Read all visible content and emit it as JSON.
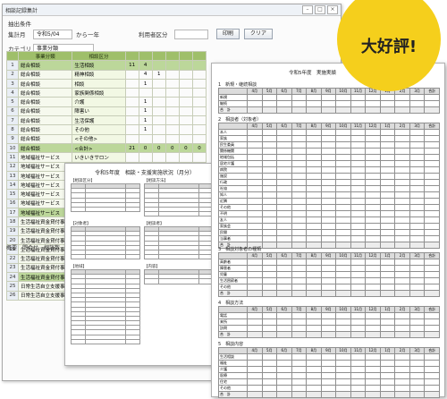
{
  "back_window": {
    "title": "相談記録集計",
    "caption": "抽出条件",
    "filter_row1": {
      "label": "集計月",
      "date_from": "令和5/04",
      "range_text": "から一年",
      "division_label": "利用者区分",
      "print_button": "印刷",
      "clear_button": "クリア"
    },
    "filter_row2": {
      "label": "カテゴリ",
      "category_value": "事業分類"
    },
    "grid": {
      "headers": [
        "事業分類",
        "相談区分",
        "",
        "",
        "",
        "",
        "",
        ""
      ],
      "rows": [
        {
          "n": "1",
          "a": "総合相談",
          "b": "生活相談",
          "v": [
            "11",
            "4",
            "",
            "",
            "",
            ""
          ],
          "hl": true
        },
        {
          "n": "2",
          "a": "総合相談",
          "b": "精神相談",
          "v": [
            "",
            "4",
            "1",
            "",
            "",
            ""
          ]
        },
        {
          "n": "3",
          "a": "総合相談",
          "b": "相談",
          "v": [
            "",
            "1",
            "",
            "",
            "",
            ""
          ]
        },
        {
          "n": "4",
          "a": "総合相談",
          "b": "家族関係相談",
          "v": [
            "",
            "",
            "",
            "",
            "",
            ""
          ]
        },
        {
          "n": "5",
          "a": "総合相談",
          "b": "介護",
          "v": [
            "",
            "1",
            "",
            "",
            "",
            ""
          ]
        },
        {
          "n": "6",
          "a": "総合相談",
          "b": "障害い",
          "v": [
            "",
            "1",
            "",
            "",
            "",
            ""
          ]
        },
        {
          "n": "7",
          "a": "総合相談",
          "b": "生活保護",
          "v": [
            "",
            "1",
            "",
            "",
            "",
            ""
          ]
        },
        {
          "n": "8",
          "a": "総合相談",
          "b": "その他",
          "v": [
            "",
            "1",
            "",
            "",
            "",
            ""
          ]
        },
        {
          "n": "9",
          "a": "総合相談",
          "b": "<その他>",
          "v": [
            "",
            "",
            "",
            "",
            "",
            ""
          ]
        },
        {
          "n": "10",
          "a": "総合相談",
          "b": "<合計>",
          "v": [
            "21",
            "0",
            "0",
            "0",
            "0",
            "0"
          ],
          "hl": true
        },
        {
          "n": "11",
          "a": "地域福祉サービス",
          "b": "いきいきサロン",
          "v": [
            "",
            "",
            "",
            "",
            "",
            ""
          ]
        },
        {
          "n": "12",
          "a": "地域福祉サービス",
          "b": "見守り事業",
          "v": [
            "",
            "",
            "",
            "",
            "",
            ""
          ]
        },
        {
          "n": "13",
          "a": "地域福祉サービス",
          "b": "福祉事業運営",
          "v": [
            "",
            "",
            "",
            "",
            "",
            ""
          ]
        },
        {
          "n": "14",
          "a": "地域福祉サービス",
          "b": "",
          "v": [
            "",
            "",
            "",
            "",
            "",
            ""
          ]
        },
        {
          "n": "15",
          "a": "地域福祉サービス",
          "b": "",
          "v": [
            "",
            "",
            "",
            "",
            "",
            ""
          ]
        },
        {
          "n": "16",
          "a": "地域福祉サービス",
          "b": "",
          "v": [
            "",
            "",
            "",
            "",
            "",
            ""
          ]
        },
        {
          "n": "17",
          "a": "地域福祉サービス",
          "b": "",
          "v": [
            "",
            "",
            "",
            "",
            "",
            ""
          ],
          "hl": true
        },
        {
          "n": "18",
          "a": "生活福祉資金貸付事業",
          "b": "",
          "v": [
            "",
            "",
            "",
            "",
            "",
            ""
          ]
        },
        {
          "n": "19",
          "a": "生活福祉資金貸付事業",
          "b": "",
          "v": [
            "",
            "",
            "",
            "",
            "",
            ""
          ]
        },
        {
          "n": "20",
          "a": "生活福祉資金貸付事業",
          "b": "",
          "v": [
            "",
            "",
            "",
            "",
            "",
            ""
          ]
        },
        {
          "n": "21",
          "a": "生活福祉資金貸付事業",
          "b": "",
          "v": [
            "",
            "",
            "",
            "",
            "",
            ""
          ]
        },
        {
          "n": "22",
          "a": "生活福祉資金貸付事業",
          "b": "",
          "v": [
            "",
            "",
            "",
            "",
            "",
            ""
          ]
        },
        {
          "n": "23",
          "a": "生活福祉資金貸付事業",
          "b": "",
          "v": [
            "",
            "",
            "",
            "",
            "",
            ""
          ]
        },
        {
          "n": "24",
          "a": "生活福祉資金貸付事業",
          "b": "",
          "v": [
            "",
            "",
            "",
            "",
            "",
            ""
          ],
          "hl": true
        },
        {
          "n": "25",
          "a": "日常生活自立支援事業",
          "b": "",
          "v": [
            "",
            "",
            "",
            "",
            "",
            ""
          ]
        },
        {
          "n": "26",
          "a": "日常生活自立支援事業",
          "b": "",
          "v": [
            "",
            "",
            "",
            "",
            "",
            ""
          ]
        }
      ]
    },
    "status": "概要　問合せ　相談数"
  },
  "middle_sheet": {
    "heading": "令和5年度　相談・支援実施状況（月分）",
    "labels": [
      "【相談区分】",
      "【相談方法】",
      "【対象者】",
      "【相談者】",
      "【地域】",
      "【内容】"
    ]
  },
  "front_sheet": {
    "heading": "令和5年度　実施実績",
    "months": [
      "4月",
      "5月",
      "6月",
      "7月",
      "8月",
      "9月",
      "10月",
      "11月",
      "12月",
      "1月",
      "2月",
      "3月",
      "合計"
    ],
    "sections": [
      {
        "title": "1　新規・継続相談",
        "rows": [
          "新規",
          "継続"
        ]
      },
      {
        "title": "2　相談者（対象者）",
        "rows": [
          "本人",
          "家族",
          "民生委員",
          "関係機関",
          "地域包括",
          "居宅介護",
          "病院",
          "施設",
          "行政",
          "社協",
          "知人",
          "近隣",
          "その他",
          "不明",
          "友人",
          "家族会",
          "民間",
          "当事者"
        ]
      },
      {
        "title": "3　相談対象者の種類",
        "rows": [
          "高齢者",
          "障害者",
          "児童",
          "生活困窮者",
          "その他"
        ]
      },
      {
        "title": "4　相談方法",
        "rows": [
          "電話",
          "来所",
          "訪問"
        ]
      },
      {
        "title": "5　相談内容",
        "rows": [
          "生活相談",
          "福祉",
          "介護",
          "医療",
          "住宅",
          "その他"
        ]
      }
    ],
    "total_label": "合　計"
  },
  "badge": {
    "text": "大好評!",
    "color": "#f5cf1c"
  }
}
